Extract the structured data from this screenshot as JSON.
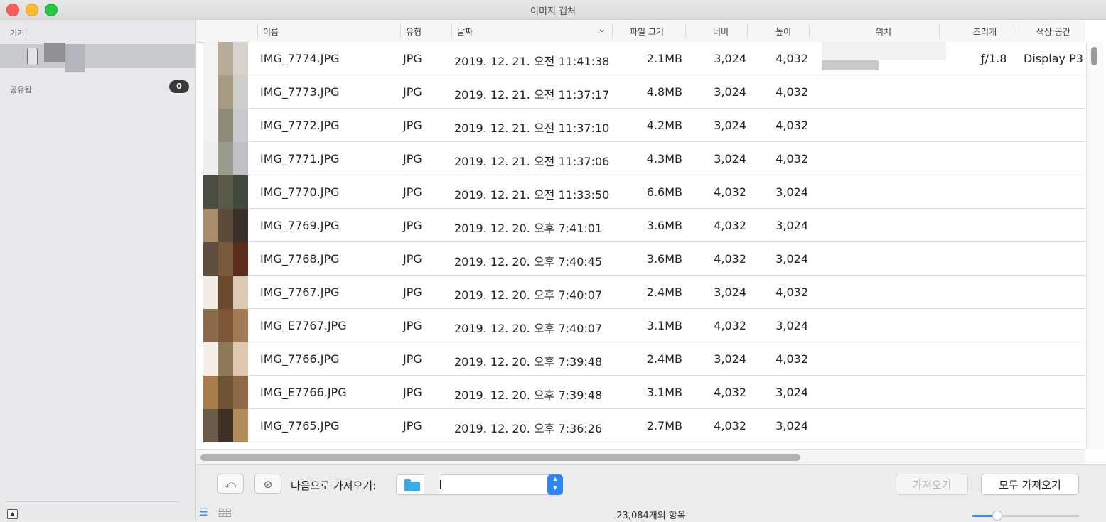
{
  "window": {
    "title": "이미지 캡처"
  },
  "sidebar": {
    "devices_heading": "기기",
    "shared_heading": "공유됨",
    "shared_count": "0"
  },
  "columns": {
    "name": "이름",
    "type": "유형",
    "date": "날짜",
    "size": "파일 크기",
    "width": "너비",
    "height": "높이",
    "location": "위치",
    "aperture": "조리개",
    "color_space": "색상 공간"
  },
  "rows": [
    {
      "name": "IMG_7774.JPG",
      "type": "JPG",
      "date": "2019. 12. 21. 오전 11:41:38",
      "size": "2.1MB",
      "width": "3,024",
      "height": "4,032",
      "aperture": "ƒ/1.8",
      "color_space": "Display P3"
    },
    {
      "name": "IMG_7773.JPG",
      "type": "JPG",
      "date": "2019. 12. 21. 오전 11:37:17",
      "size": "4.8MB",
      "width": "3,024",
      "height": "4,032",
      "aperture": "",
      "color_space": ""
    },
    {
      "name": "IMG_7772.JPG",
      "type": "JPG",
      "date": "2019. 12. 21. 오전 11:37:10",
      "size": "4.2MB",
      "width": "3,024",
      "height": "4,032",
      "aperture": "",
      "color_space": ""
    },
    {
      "name": "IMG_7771.JPG",
      "type": "JPG",
      "date": "2019. 12. 21. 오전 11:37:06",
      "size": "4.3MB",
      "width": "3,024",
      "height": "4,032",
      "aperture": "",
      "color_space": ""
    },
    {
      "name": "IMG_7770.JPG",
      "type": "JPG",
      "date": "2019. 12. 21. 오전 11:33:50",
      "size": "6.6MB",
      "width": "4,032",
      "height": "3,024",
      "aperture": "",
      "color_space": ""
    },
    {
      "name": "IMG_7769.JPG",
      "type": "JPG",
      "date": "2019. 12. 20. 오후 7:41:01",
      "size": "3.6MB",
      "width": "4,032",
      "height": "3,024",
      "aperture": "",
      "color_space": ""
    },
    {
      "name": "IMG_7768.JPG",
      "type": "JPG",
      "date": "2019. 12. 20. 오후 7:40:45",
      "size": "3.6MB",
      "width": "4,032",
      "height": "3,024",
      "aperture": "",
      "color_space": ""
    },
    {
      "name": "IMG_7767.JPG",
      "type": "JPG",
      "date": "2019. 12. 20. 오후 7:40:07",
      "size": "2.4MB",
      "width": "3,024",
      "height": "4,032",
      "aperture": "",
      "color_space": ""
    },
    {
      "name": "IMG_E7767.JPG",
      "type": "JPG",
      "date": "2019. 12. 20. 오후 7:40:07",
      "size": "3.1MB",
      "width": "4,032",
      "height": "3,024",
      "aperture": "",
      "color_space": ""
    },
    {
      "name": "IMG_7766.JPG",
      "type": "JPG",
      "date": "2019. 12. 20. 오후 7:39:48",
      "size": "2.4MB",
      "width": "3,024",
      "height": "4,032",
      "aperture": "",
      "color_space": ""
    },
    {
      "name": "IMG_E7766.JPG",
      "type": "JPG",
      "date": "2019. 12. 20. 오후 7:39:48",
      "size": "3.1MB",
      "width": "4,032",
      "height": "3,024",
      "aperture": "",
      "color_space": ""
    },
    {
      "name": "IMG_7765.JPG",
      "type": "JPG",
      "date": "2019. 12. 20. 오후 7:36:26",
      "size": "2.7MB",
      "width": "4,032",
      "height": "3,024",
      "aperture": "",
      "color_space": ""
    }
  ],
  "thumbnail_colors": [
    [
      "#f3f3f3",
      "#b8ab98",
      "#d6d4cd"
    ],
    [
      "#f4f4f4",
      "#a79b82",
      "#cfcfca"
    ],
    [
      "#f2f2f2",
      "#8d8a79",
      "#c8c8cf"
    ],
    [
      "#eeeeee",
      "#9a9b8c",
      "#bfc0c6"
    ],
    [
      "#4b4d42",
      "#5a5948",
      "#3f4a3c"
    ],
    [
      "#a98c6d",
      "#5c4b3b",
      "#3a3029"
    ],
    [
      "#5d4e3e",
      "#7a5a3c",
      "#5c2c1b"
    ],
    [
      "#f1ece6",
      "#6a4a2c",
      "#dcc9b6"
    ],
    [
      "#8a6c4c",
      "#7c5636",
      "#a17a55"
    ],
    [
      "#f5efe9",
      "#8c7a57",
      "#dfc8b0"
    ],
    [
      "#a97c48",
      "#6e5434",
      "#8e6a4a"
    ],
    [
      "#6b5a47",
      "#3e3024",
      "#b08b5a"
    ]
  ],
  "footer": {
    "import_to_label": "다음으로 가져오기:",
    "import_button": "가져오기",
    "import_all_button": "모두 가져오기",
    "item_count": "23,084개의 항목",
    "thumbnail_size": 0.23
  }
}
